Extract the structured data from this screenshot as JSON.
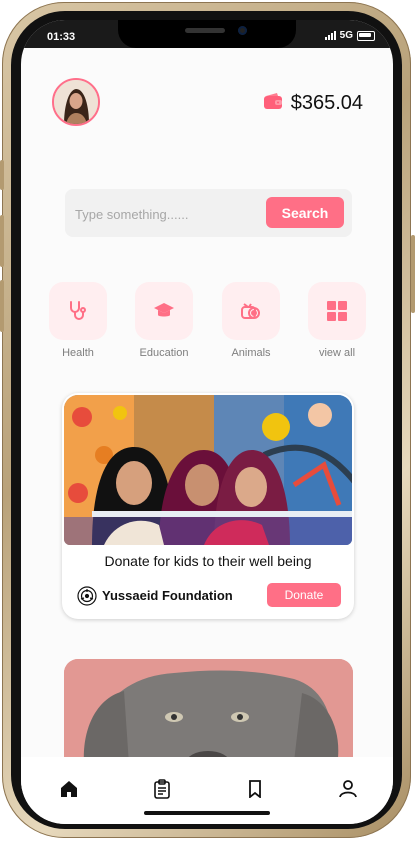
{
  "status_bar": {
    "time": "01:33",
    "network": "5G"
  },
  "header": {
    "balance": "$365.04"
  },
  "search": {
    "placeholder": "Type something......",
    "button_label": "Search"
  },
  "categories": [
    {
      "label": "Health",
      "icon": "stethoscope-icon"
    },
    {
      "label": "Education",
      "icon": "graduation-cap-icon"
    },
    {
      "label": "Animals",
      "icon": "animal-icon"
    },
    {
      "label": "view all",
      "icon": "grid-icon"
    }
  ],
  "cards": [
    {
      "title": "Donate for kids to their well being",
      "organization": "Yussaeid Foundation",
      "button_label": "Donate"
    }
  ],
  "nav": [
    {
      "icon": "home-icon"
    },
    {
      "icon": "clipboard-icon"
    },
    {
      "icon": "bookmark-icon"
    },
    {
      "icon": "user-icon"
    }
  ],
  "colors": {
    "accent": "#ff6f86",
    "tile_bg": "#ffeef0"
  }
}
